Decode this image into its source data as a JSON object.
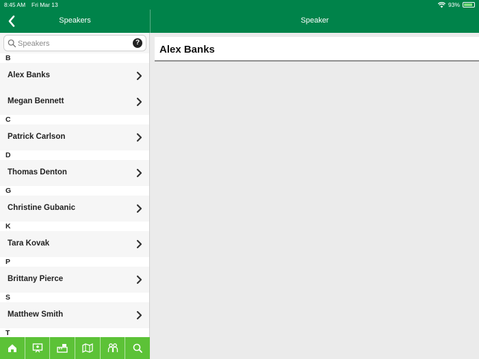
{
  "status_bar": {
    "time": "8:45 AM",
    "date": "Fri Mar 13",
    "battery": "93%"
  },
  "nav": {
    "left_title": "Speakers",
    "right_title": "Speaker"
  },
  "search": {
    "placeholder": "Speakers"
  },
  "sections": [
    {
      "letter": "B",
      "speakers": [
        "Alex Banks",
        "Megan Bennett"
      ]
    },
    {
      "letter": "C",
      "speakers": [
        "Patrick Carlson"
      ]
    },
    {
      "letter": "D",
      "speakers": [
        "Thomas Denton"
      ]
    },
    {
      "letter": "G",
      "speakers": [
        "Christine Gubanic"
      ]
    },
    {
      "letter": "K",
      "speakers": [
        "Tara Kovak"
      ]
    },
    {
      "letter": "P",
      "speakers": [
        "Brittany Pierce"
      ]
    },
    {
      "letter": "S",
      "speakers": [
        "Matthew Smith"
      ]
    },
    {
      "letter": "T",
      "speakers": []
    }
  ],
  "detail": {
    "name": "Alex Banks"
  },
  "tabbar": {
    "icons": [
      "home-icon",
      "presentation-icon",
      "exhibitor-icon",
      "map-icon",
      "people-icon",
      "search-icon"
    ]
  },
  "colors": {
    "header_green": "#00834a",
    "tabbar_green": "#5cc237"
  }
}
